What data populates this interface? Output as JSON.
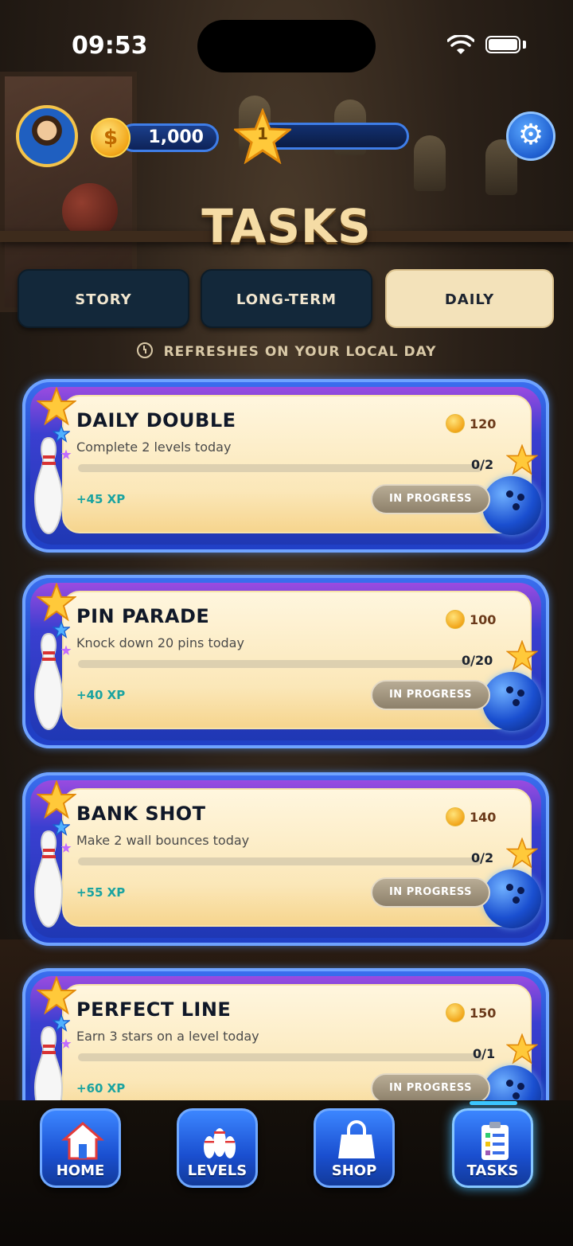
{
  "status_bar": {
    "time": "09:53"
  },
  "header": {
    "coins": "1,000",
    "coin_symbol": "$",
    "level": "1",
    "level_progress": 0.0,
    "settings_icon": "gear-icon"
  },
  "page": {
    "title": "TASKS",
    "tabs": [
      {
        "label": "STORY",
        "active": false
      },
      {
        "label": "LONG-TERM",
        "active": false
      },
      {
        "label": "DAILY",
        "active": true
      }
    ],
    "refresh_note": "REFRESHES ON YOUR LOCAL DAY"
  },
  "tasks": [
    {
      "name": "DAILY DOUBLE",
      "description": "Complete 2 levels today",
      "reward": "120",
      "progress": "0/2",
      "progress_fraction": 0.0,
      "xp": "+45 XP",
      "status": "IN PROGRESS"
    },
    {
      "name": "PIN PARADE",
      "description": "Knock down 20 pins today",
      "reward": "100",
      "progress": "0/20",
      "progress_fraction": 0.0,
      "xp": "+40 XP",
      "status": "IN PROGRESS"
    },
    {
      "name": "BANK SHOT",
      "description": "Make 2 wall bounces today",
      "reward": "140",
      "progress": "0/2",
      "progress_fraction": 0.0,
      "xp": "+55 XP",
      "status": "IN PROGRESS"
    },
    {
      "name": "PERFECT LINE",
      "description": "Earn 3 stars on a level today",
      "reward": "150",
      "progress": "0/1",
      "progress_fraction": 0.0,
      "xp": "+60 XP",
      "status": "IN PROGRESS"
    }
  ],
  "nav": {
    "items": [
      {
        "label": "HOME",
        "icon": "house-icon",
        "active": false
      },
      {
        "label": "LEVELS",
        "icon": "bowling-pins-icon",
        "active": false
      },
      {
        "label": "SHOP",
        "icon": "shopping-bag-icon",
        "active": false
      },
      {
        "label": "TASKS",
        "icon": "clipboard-checklist-icon",
        "active": true
      }
    ]
  },
  "colors": {
    "title_gold": "#f5dca5",
    "tab_active_bg": "#f3e2ba",
    "tab_inactive_bg": "#13283a",
    "card_blue": "#1d3cb8",
    "xp_teal": "#1aa3a0",
    "status_grey": "#8d806a"
  }
}
